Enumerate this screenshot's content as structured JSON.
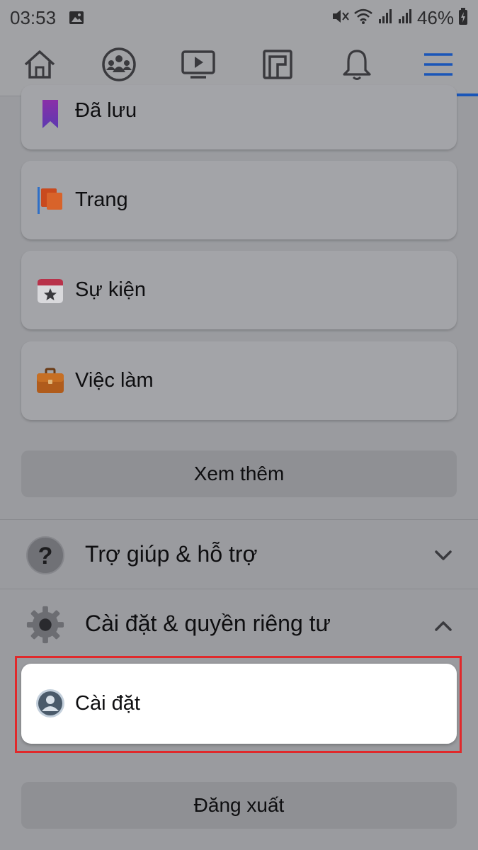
{
  "status_bar": {
    "time": "03:53",
    "battery_percent": "46%",
    "icons": [
      "gallery-icon",
      "mute-icon",
      "wifi-icon",
      "signal-icon",
      "signal-icon",
      "battery-charging-icon"
    ]
  },
  "nav": {
    "tabs": [
      {
        "name": "home",
        "icon": "home-icon",
        "active": false
      },
      {
        "name": "groups",
        "icon": "groups-icon",
        "active": false
      },
      {
        "name": "watch",
        "icon": "video-icon",
        "active": false
      },
      {
        "name": "marketplace",
        "icon": "marketplace-icon",
        "active": false
      },
      {
        "name": "notifications",
        "icon": "bell-icon",
        "active": false
      },
      {
        "name": "menu",
        "icon": "menu-icon",
        "active": true
      }
    ],
    "accent": "#1a56b8"
  },
  "menu": {
    "items": [
      {
        "label": "Đã lưu",
        "icon": "bookmark-icon"
      },
      {
        "label": "Trang",
        "icon": "flag-icon"
      },
      {
        "label": "Sự kiện",
        "icon": "calendar-icon"
      },
      {
        "label": "Việc làm",
        "icon": "briefcase-icon"
      }
    ],
    "see_more": "Xem thêm"
  },
  "sections": {
    "help": {
      "label": "Trợ giúp & hỗ trợ",
      "icon": "question-icon",
      "expanded": false
    },
    "settings_privacy": {
      "label": "Cài đặt & quyền riêng tư",
      "icon": "gear-icon",
      "expanded": true
    },
    "settings_item": {
      "label": "Cài đặt",
      "icon": "user-circle-icon",
      "highlight_color": "#e0292b"
    }
  },
  "logout": "Đăng xuất"
}
